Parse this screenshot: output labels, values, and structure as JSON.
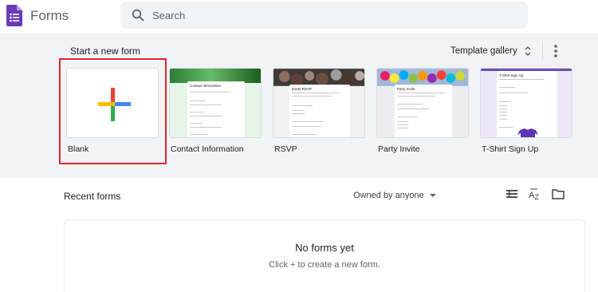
{
  "header": {
    "app_title": "Forms",
    "logo_icon": "forms-logo-icon",
    "search": {
      "placeholder": "Search",
      "value": ""
    }
  },
  "templates": {
    "section_title": "Start a new form",
    "gallery_label": "Template gallery",
    "items": [
      {
        "label": "Blank",
        "highlighted": true
      },
      {
        "label": "Contact Information",
        "preview_title": "Contact information",
        "banner_color": "#2e7d32"
      },
      {
        "label": "RSVP",
        "preview_title": "Event RSVP"
      },
      {
        "label": "Party Invite",
        "preview_title": "Party Invite"
      },
      {
        "label": "T-Shirt Sign Up",
        "preview_title": "T-Shirt Sign Up",
        "banner_color": "#6a4fb3"
      }
    ]
  },
  "recent": {
    "title": "Recent forms",
    "owner_filter": "Owned by anyone",
    "empty_title": "No forms yet",
    "empty_subtitle": "Click + to create a new form."
  },
  "colors": {
    "brand_purple": "#673ab7",
    "highlight_red": "#e0262b",
    "plus_red": "#ea4335",
    "plus_blue": "#4285f4",
    "plus_green": "#34a853",
    "plus_yellow": "#fbbc04"
  }
}
